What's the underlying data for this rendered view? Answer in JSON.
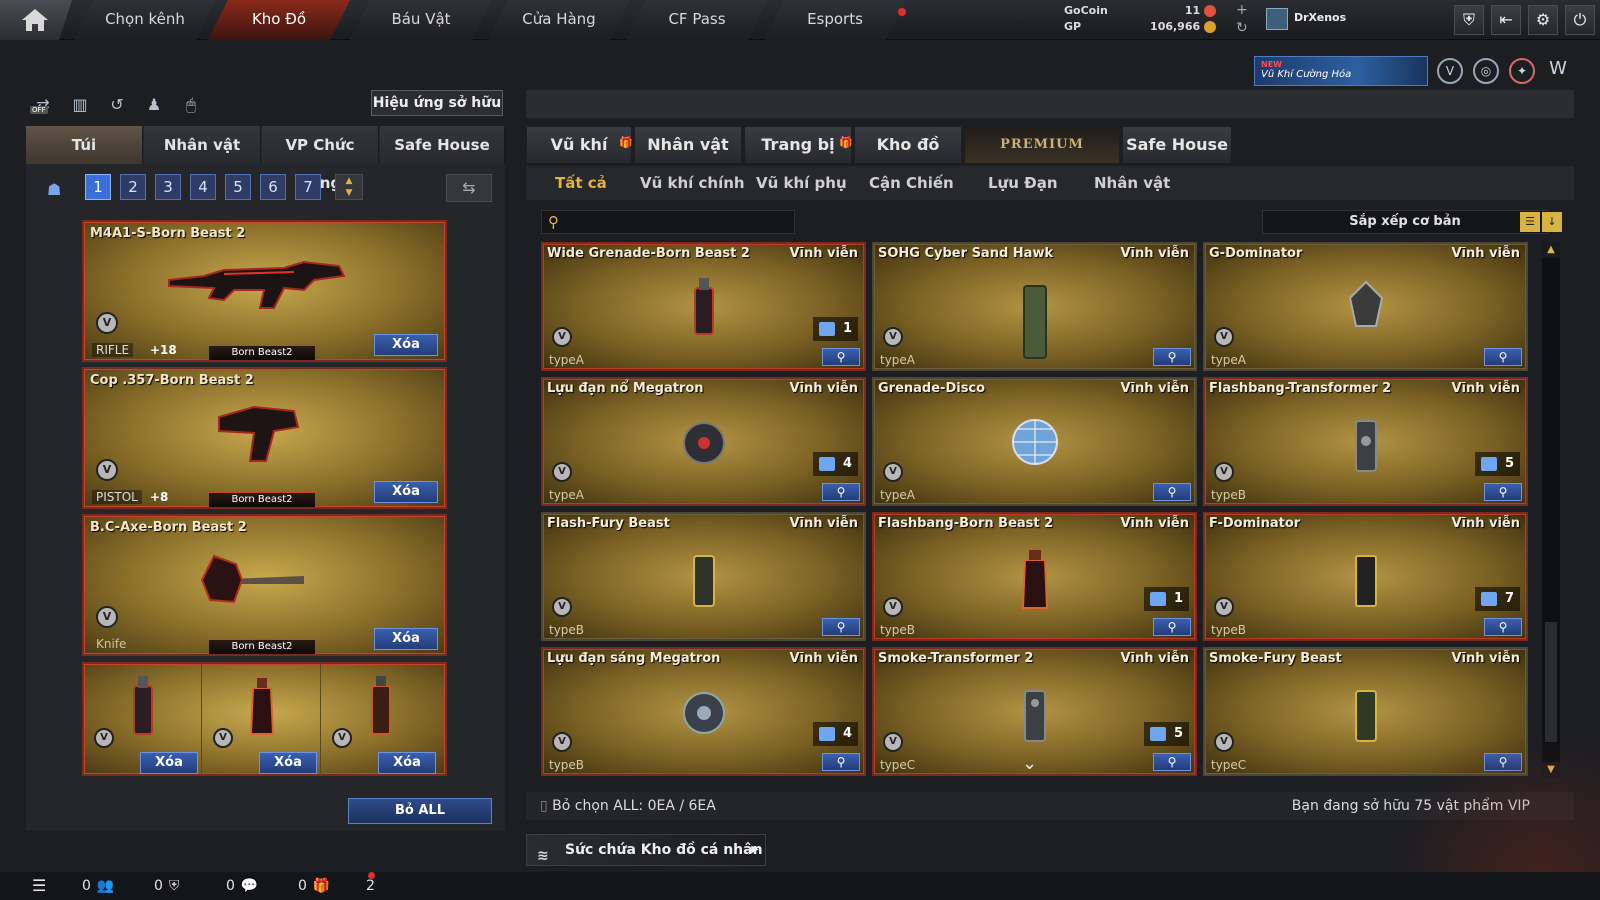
{
  "topnav": {
    "tabs": [
      {
        "label": "Chọn kênh"
      },
      {
        "label": "Kho Đồ",
        "active": true
      },
      {
        "label": "Báu Vật"
      },
      {
        "label": "Cửa Hàng"
      },
      {
        "label": "CF Pass"
      },
      {
        "label": "Esports"
      }
    ],
    "gocoin_label": "GoCoin",
    "gocoin_value": "11",
    "gp_label": "GP",
    "gp_value": "106,966",
    "username": "DrXenos"
  },
  "banner": {
    "badge": "NEW",
    "text": "Vũ Khí Cường Hóa"
  },
  "left": {
    "owned_effect_label": "Hiệu ứng sở hữu",
    "off_label": "OFF",
    "tabs": [
      {
        "label": "Túi",
        "active": true
      },
      {
        "label": "Nhân vật"
      },
      {
        "label": "VP Chức năng"
      },
      {
        "label": "Safe House"
      }
    ],
    "pages": [
      "1",
      "2",
      "3",
      "4",
      "5",
      "6",
      "7"
    ],
    "active_page": "1",
    "equipped": [
      {
        "name": "M4A1-S-Born Beast 2",
        "type": "RIFLE",
        "plus": "+18",
        "badge": "Born Beast2",
        "delete": "Xóa"
      },
      {
        "name": "Cop .357-Born Beast 2",
        "type": "PISTOL",
        "plus": "+8",
        "badge": "Born Beast2",
        "delete": "Xóa"
      },
      {
        "name": "B.C-Axe-Born Beast 2",
        "type": "Knife",
        "plus": "",
        "badge": "Born Beast2",
        "delete": "Xóa"
      }
    ],
    "grenade_slots": [
      {
        "delete": "Xóa"
      },
      {
        "delete": "Xóa"
      },
      {
        "delete": "Xóa"
      }
    ],
    "clear_all": "Bỏ ALL"
  },
  "right": {
    "tabs": [
      {
        "label": "Vũ khí",
        "gift": true
      },
      {
        "label": "Nhân vật"
      },
      {
        "label": "Trang bị",
        "gift": true
      },
      {
        "label": "Kho đồ"
      },
      {
        "label": "PREMIUM"
      },
      {
        "label": "Safe House"
      }
    ],
    "subtabs": [
      "Tất cả",
      "Vũ khí chính",
      "Vũ khí phụ",
      "Cận Chiến",
      "Lựu Đạn",
      "Nhân vật"
    ],
    "active_subtab": "Tất cả",
    "search_placeholder": "",
    "sort_label": "Sắp xếp cơ bản",
    "items": [
      {
        "name": "Wide Grenade-Born Beast 2",
        "duration": "Vĩnh viễn",
        "type": "typeA",
        "count": "1",
        "highlight": true
      },
      {
        "name": "SOHG Cyber Sand Hawk",
        "duration": "Vĩnh viễn",
        "type": "typeA",
        "count": "",
        "highlight": false
      },
      {
        "name": "G-Dominator",
        "duration": "Vĩnh viễn",
        "type": "typeA",
        "count": "",
        "highlight": false
      },
      {
        "name": "Lựu đạn nổ Megatron",
        "duration": "Vĩnh viễn",
        "type": "typeA",
        "count": "4",
        "highlight": true
      },
      {
        "name": "Grenade-Disco",
        "duration": "Vĩnh viễn",
        "type": "typeA",
        "count": "",
        "highlight": false
      },
      {
        "name": "Flashbang-Transformer 2",
        "duration": "Vĩnh viễn",
        "type": "typeB",
        "count": "5",
        "highlight": true
      },
      {
        "name": "Flash-Fury Beast",
        "duration": "Vĩnh viễn",
        "type": "typeB",
        "count": "",
        "highlight": false
      },
      {
        "name": "Flashbang-Born Beast 2",
        "duration": "Vĩnh viễn",
        "type": "typeB",
        "count": "1",
        "highlight": true
      },
      {
        "name": "F-Dominator",
        "duration": "Vĩnh viễn",
        "type": "typeB",
        "count": "7",
        "highlight": true
      },
      {
        "name": "Lựu đạn sáng Megatron",
        "duration": "Vĩnh viễn",
        "type": "typeB",
        "count": "4",
        "highlight": true
      },
      {
        "name": "Smoke-Transformer 2",
        "duration": "Vĩnh viễn",
        "type": "typeC",
        "count": "5",
        "highlight": true
      },
      {
        "name": "Smoke-Fury Beast",
        "duration": "Vĩnh viễn",
        "type": "typeC",
        "count": "",
        "highlight": false
      }
    ],
    "deselect_all": "Bỏ chọn ALL: 0EA / 6EA",
    "vip_owned": "Bạn đang sở hữu 75 vật phẩm VIP",
    "capacity_label": "Sức chứa Kho đồ cá nhân"
  },
  "bottombar": {
    "stats": [
      "0",
      "0",
      "0",
      "0",
      "2"
    ]
  },
  "colors": {
    "accent_gold": "#e2b544",
    "accent_red": "#c7442a",
    "blue_button": "#3a5fb0"
  }
}
